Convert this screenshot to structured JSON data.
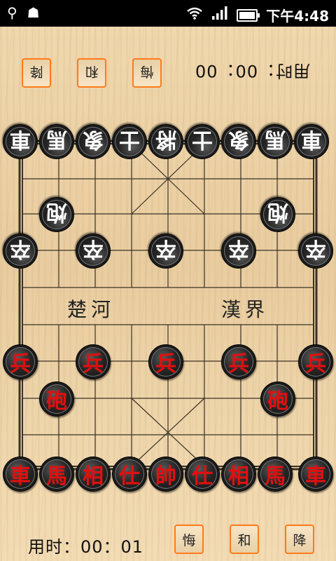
{
  "status_bar": {
    "time": "下午4:48",
    "icons": [
      "usb-icon",
      "android-icon",
      "wifi-icon",
      "signal-icon",
      "battery-icon"
    ]
  },
  "opponent": {
    "buttons": [
      "降",
      "和",
      "悔"
    ],
    "timer": "用时：00：00"
  },
  "player": {
    "buttons": [
      "悔",
      "和",
      "降"
    ],
    "timer": "用时：00：01"
  },
  "river": {
    "left": "楚河",
    "right": "漢界"
  },
  "board": {
    "black_back_row": [
      "車",
      "馬",
      "象",
      "士",
      "將",
      "士",
      "象",
      "馬",
      "車"
    ],
    "black_cannons": [
      "炮",
      "炮"
    ],
    "black_soldiers": [
      "卒",
      "卒",
      "卒",
      "卒",
      "卒"
    ],
    "red_soldiers": [
      "兵",
      "兵",
      "兵",
      "兵",
      "兵"
    ],
    "red_cannons": [
      "砲",
      "砲"
    ],
    "red_back_row": [
      "車",
      "馬",
      "相",
      "仕",
      "帥",
      "仕",
      "相",
      "馬",
      "車"
    ]
  },
  "colors": {
    "accent": "#ff7a1a",
    "red_piece_text": "#e01010",
    "board_wood": "#ecd2a6"
  }
}
